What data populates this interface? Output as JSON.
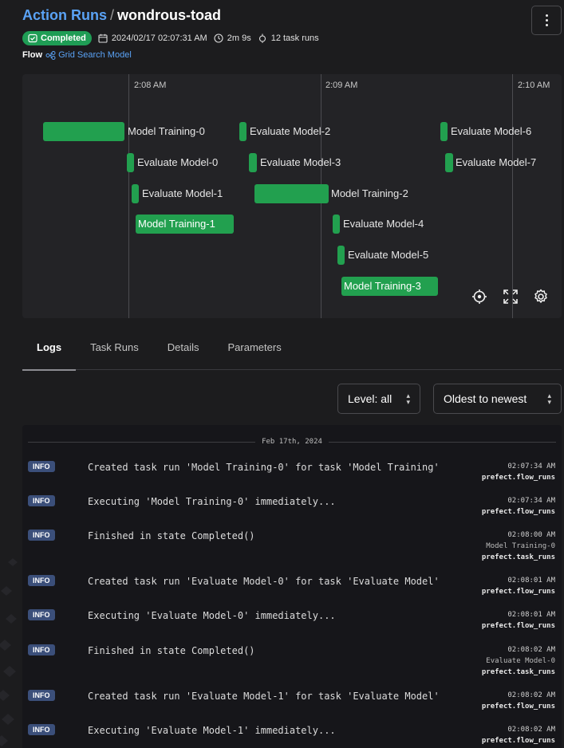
{
  "header": {
    "crumb_link": "Action Runs",
    "separator": "/",
    "run_name": "wondrous-toad"
  },
  "meta": {
    "status": "Completed",
    "start_time": "2024/02/17 02:07:31 AM",
    "duration": "2m 9s",
    "task_runs": "12 task runs"
  },
  "flow": {
    "label": "Flow",
    "name": "Grid Search Model"
  },
  "timeline": {
    "time_labels": [
      "2:08 AM",
      "2:09 AM",
      "2:10 AM"
    ],
    "bars": [
      {
        "label": "Model Training-0"
      },
      {
        "label": "Evaluate Model-0"
      },
      {
        "label": "Evaluate Model-1"
      },
      {
        "label": "Model Training-1"
      },
      {
        "label": "Evaluate Model-2"
      },
      {
        "label": "Evaluate Model-3"
      },
      {
        "label": "Model Training-2"
      },
      {
        "label": "Evaluate Model-4"
      },
      {
        "label": "Evaluate Model-5"
      },
      {
        "label": "Model Training-3"
      },
      {
        "label": "Evaluate Model-6"
      },
      {
        "label": "Evaluate Model-7"
      }
    ],
    "bar_color": "#22a04f"
  },
  "tabs": [
    {
      "label": "Logs"
    },
    {
      "label": "Task Runs"
    },
    {
      "label": "Details"
    },
    {
      "label": "Parameters"
    }
  ],
  "filters": {
    "level": "Level: all",
    "order": "Oldest to newest"
  },
  "logs": {
    "date": "Feb 17th, 2024",
    "entries": [
      {
        "level": "INFO",
        "message": "Created task run 'Model Training-0' for task 'Model Training'",
        "time": "02:07:34 AM",
        "task": "",
        "source": "prefect.flow_runs"
      },
      {
        "level": "INFO",
        "message": "Executing 'Model Training-0' immediately...",
        "time": "02:07:34 AM",
        "task": "",
        "source": "prefect.flow_runs"
      },
      {
        "level": "INFO",
        "message": "Finished in state Completed()",
        "time": "02:08:00 AM",
        "task": "Model Training-0",
        "source": "prefect.task_runs"
      },
      {
        "level": "INFO",
        "message": "Created task run 'Evaluate Model-0' for task 'Evaluate Model'",
        "time": "02:08:01 AM",
        "task": "",
        "source": "prefect.flow_runs"
      },
      {
        "level": "INFO",
        "message": "Executing 'Evaluate Model-0' immediately...",
        "time": "02:08:01 AM",
        "task": "",
        "source": "prefect.flow_runs"
      },
      {
        "level": "INFO",
        "message": "Finished in state Completed()",
        "time": "02:08:02 AM",
        "task": "Evaluate Model-0",
        "source": "prefect.task_runs"
      },
      {
        "level": "INFO",
        "message": "Created task run 'Evaluate Model-1' for task 'Evaluate Model'",
        "time": "02:08:02 AM",
        "task": "",
        "source": "prefect.flow_runs"
      },
      {
        "level": "INFO",
        "message": "Executing 'Evaluate Model-1' immediately...",
        "time": "02:08:02 AM",
        "task": "",
        "source": "prefect.flow_runs"
      }
    ]
  },
  "colors": {
    "accent": "#5aa2f5",
    "completed": "#1f9d55",
    "info_badge": "#3b4f7a"
  }
}
